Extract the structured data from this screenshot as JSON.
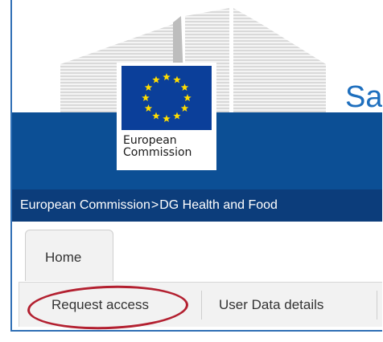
{
  "header": {
    "logo_text_line1": "European",
    "logo_text_line2": "Commission",
    "site_title": "Sa"
  },
  "breadcrumb": {
    "items": [
      "European Commission",
      "DG Health and Food"
    ],
    "separator": ">"
  },
  "tabs": {
    "home_label": "Home"
  },
  "subnav": {
    "items": [
      "Request access",
      "User Data details"
    ]
  },
  "colors": {
    "eu_blue": "#0b3f9a",
    "header_band": "#0c4f95",
    "breadcrumb_bar": "#0c3d7b",
    "title_blue": "#1e6fbe",
    "highlight_red": "#b32030",
    "star_yellow": "#ffdd00"
  }
}
